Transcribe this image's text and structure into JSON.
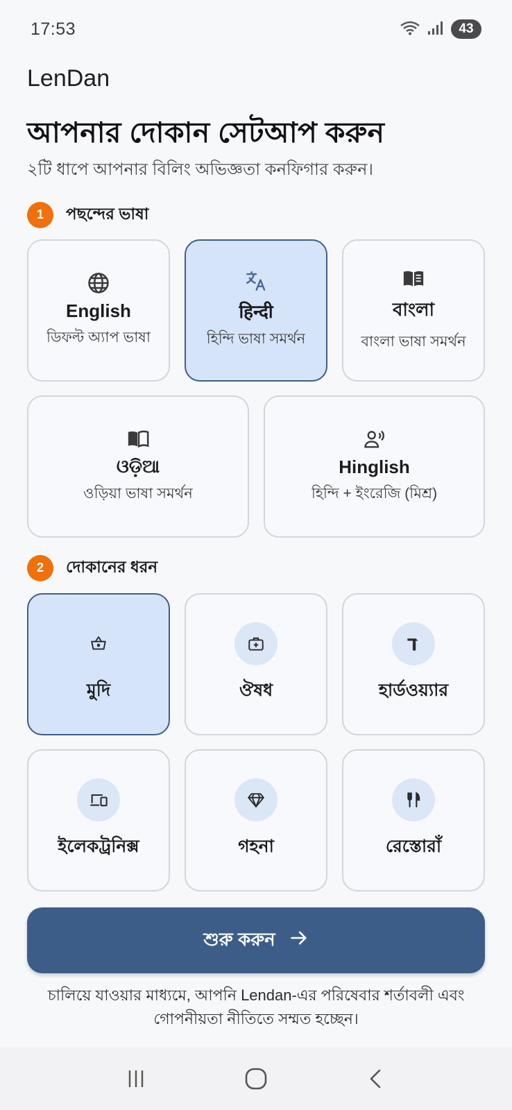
{
  "status": {
    "time": "17:53",
    "battery": "43"
  },
  "brand": "LenDan",
  "title": "আপনার দোকান সেটআপ করুন",
  "subtitle": "২টি ধাপে আপনার বিলিং অভিজ্ঞতা কনফিগার করুন।",
  "section1": {
    "step": "1",
    "label": "পছন্দের ভাষা"
  },
  "languages": [
    {
      "title": "English",
      "desc": "ডিফল্ট অ্যাপ ভাষা",
      "icon": "globe-icon",
      "selected": false
    },
    {
      "title": "हिन्दी",
      "desc": "হিন্দি ভাষা সমর্থন",
      "icon": "translate-icon",
      "selected": true
    },
    {
      "title": "বাংলা",
      "desc": "বাংলা ভাষা সমর্থন",
      "icon": "book-open-icon",
      "selected": false
    },
    {
      "title": "ଓଡ଼ିଆ",
      "desc": "ওড়িয়া ভাষা সমর্থন",
      "icon": "book-icon",
      "selected": false
    },
    {
      "title": "Hinglish",
      "desc": "হিন্দি + ইংরেজি (মিশ্র)",
      "icon": "voice-icon",
      "selected": false
    }
  ],
  "section2": {
    "step": "2",
    "label": "দোকানের ধরন"
  },
  "shops": [
    {
      "label": "মুদি",
      "icon": "basket-icon",
      "selected": true
    },
    {
      "label": "ঔষধ",
      "icon": "medical-kit-icon",
      "selected": false
    },
    {
      "label": "হার্ডওয়্যার",
      "icon": "hammer-icon",
      "selected": false
    },
    {
      "label": "ইলেকট্রনিক্স",
      "icon": "devices-icon",
      "selected": false
    },
    {
      "label": "গহনা",
      "icon": "diamond-icon",
      "selected": false
    },
    {
      "label": "রেস্তোরাঁ",
      "icon": "restaurant-icon",
      "selected": false
    }
  ],
  "start_button": {
    "label": "শুরু করুন"
  },
  "terms": "চালিয়ে যাওয়ার মাধ্যমে, আপনি Lendan-এর পরিষেবার শর্তাবলী এবং গোপনীয়তা নীতিতে সম্মত হচ্ছেন।",
  "colors": {
    "accent": "#3d5d89",
    "step_badge": "#f0700c",
    "selected_bg": "#d6e4fa",
    "icon_circle": "#dbe6f7"
  }
}
